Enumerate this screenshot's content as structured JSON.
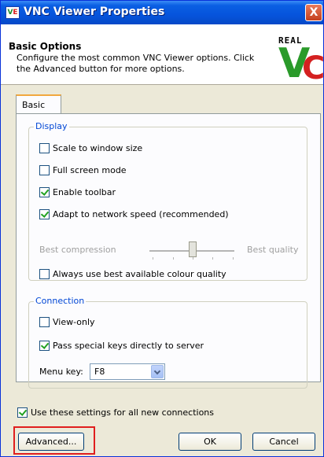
{
  "window": {
    "title": "VNC Viewer Properties",
    "close_label": "X",
    "app_icon": "vnc-app-icon",
    "app_icon_text_v": "V",
    "app_icon_text_e": "E"
  },
  "header": {
    "title": "Basic Options",
    "description": "Configure the most common VNC Viewer options. Click the Advanced button for more options.",
    "logo_text": "REAL",
    "logo_v": "V",
    "logo_c": "C"
  },
  "tabs": [
    {
      "label": "Basic",
      "selected": true
    }
  ],
  "display_group": {
    "label": "Display",
    "options": [
      {
        "label": "Scale to window size",
        "checked": false
      },
      {
        "label": "Full screen mode",
        "checked": false
      },
      {
        "label": "Enable toolbar",
        "checked": true
      },
      {
        "label": "Adapt to network speed (recommended)",
        "checked": true
      }
    ],
    "slider": {
      "left_label": "Best compression",
      "right_label": "Best quality",
      "enabled": false
    },
    "colour_option": {
      "label": "Always use best available colour quality",
      "checked": false
    }
  },
  "connection_group": {
    "label": "Connection",
    "options": [
      {
        "label": "View-only",
        "checked": false
      },
      {
        "label": "Pass special keys directly to server",
        "checked": true
      }
    ],
    "menu_key": {
      "label": "Menu key:",
      "value": "F8"
    }
  },
  "footer": {
    "all_connections": {
      "label": "Use these settings for all new connections",
      "checked": true
    },
    "advanced_button": "Advanced...",
    "ok_button": "OK",
    "cancel_button": "Cancel"
  },
  "colors": {
    "titlebar": "#0654dc",
    "group_label": "#0046d5",
    "highlight": "#e01e1e"
  }
}
